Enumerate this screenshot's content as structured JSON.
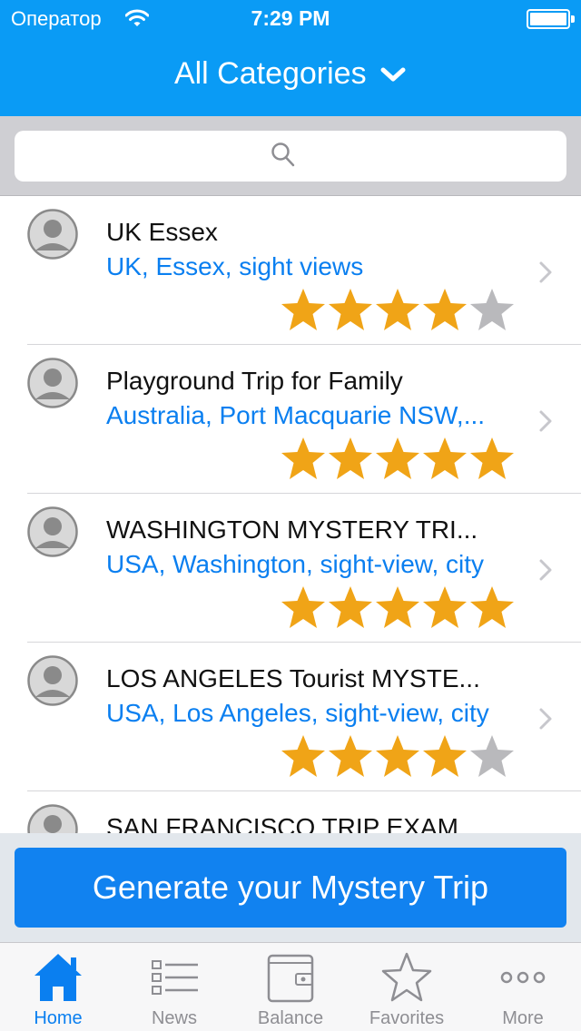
{
  "status_bar": {
    "carrier": "Оператор",
    "time": "7:29 PM"
  },
  "header": {
    "title": "All Categories",
    "dropdown_icon": "chevron-down-icon"
  },
  "search": {
    "placeholder": "",
    "icon": "search-icon"
  },
  "trips": [
    {
      "title": "UK Essex",
      "subtitle": "UK, Essex, sight views",
      "rating": 4,
      "max_rating": 5
    },
    {
      "title": "Playground Trip for Family",
      "subtitle": "Australia, Port Macquarie NSW,...",
      "rating": 5,
      "max_rating": 5
    },
    {
      "title": "WASHINGTON MYSTERY TRI...",
      "subtitle": "USA, Washington, sight-view, city",
      "rating": 5,
      "max_rating": 5
    },
    {
      "title": "LOS ANGELES Tourist MYSTE...",
      "subtitle": "USA, Los Angeles, sight-view, city",
      "rating": 4,
      "max_rating": 5
    },
    {
      "title": "SAN FRANCISCO TRIP EXAM...",
      "subtitle": "",
      "rating": 0,
      "max_rating": 5
    }
  ],
  "generate_button": {
    "label": "Generate your Mystery Trip"
  },
  "tab_bar": {
    "tabs": [
      {
        "label": "Home",
        "icon": "home-icon",
        "active": true
      },
      {
        "label": "News",
        "icon": "list-icon",
        "active": false
      },
      {
        "label": "Balance",
        "icon": "wallet-icon",
        "active": false
      },
      {
        "label": "Favorites",
        "icon": "star-icon",
        "active": false
      },
      {
        "label": "More",
        "icon": "more-icon",
        "active": false
      }
    ]
  },
  "colors": {
    "accent": "#0a9bf5",
    "link": "#0a7ff0",
    "star_filled": "#f0a417",
    "star_empty": "#b9b9bc",
    "button": "#1182f0"
  }
}
